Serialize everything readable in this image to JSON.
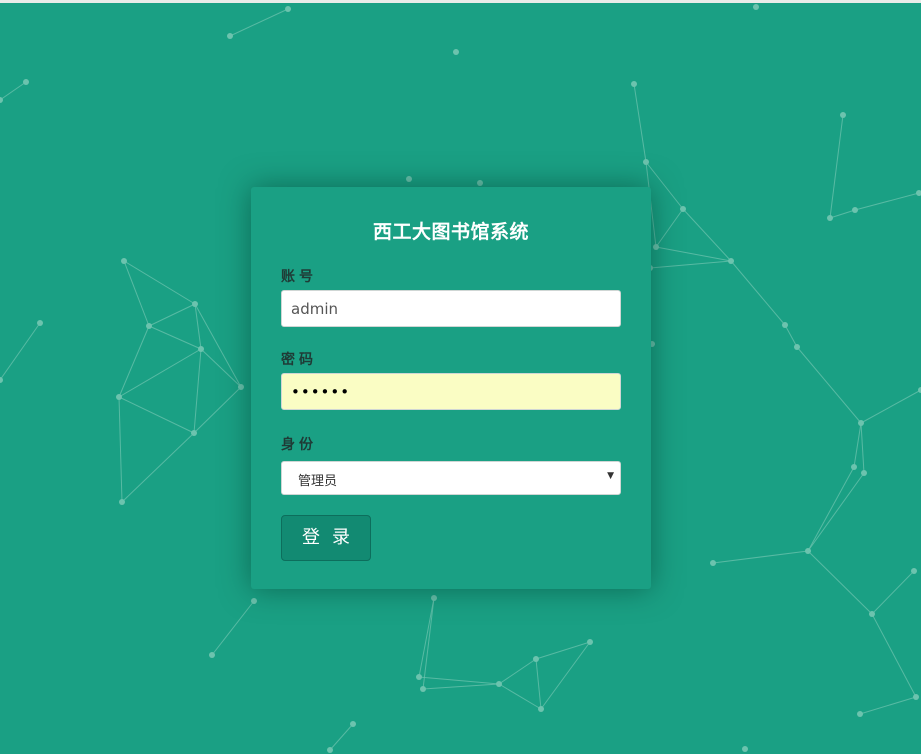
{
  "page": {
    "background_color": "#1aa084"
  },
  "login": {
    "title": "西工大图书馆系统",
    "username": {
      "label": "账号",
      "value": "admin"
    },
    "password": {
      "label": "密码",
      "value": "••••••"
    },
    "role": {
      "label": "身份",
      "selected": "管理员"
    },
    "submit_label": "登录"
  },
  "icons": {
    "select_caret": "chevron-down-icon"
  },
  "colors": {
    "accent": "#1aa084",
    "button": "#128a72",
    "autofill_bg": "#fafdc4",
    "network_line": "#6cc3ae"
  }
}
